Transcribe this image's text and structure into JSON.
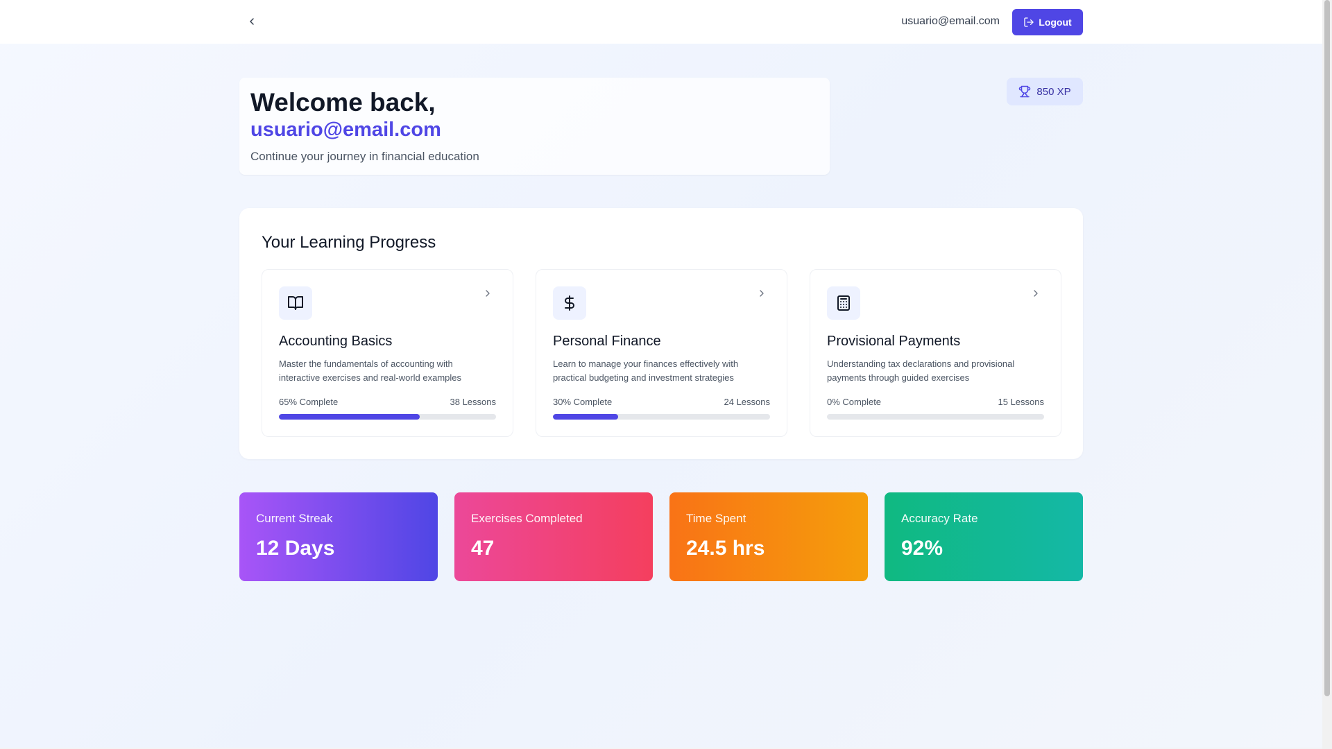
{
  "header": {
    "user_email": "usuario@email.com",
    "logout_label": "Logout"
  },
  "welcome": {
    "heading": "Welcome back,",
    "email": "usuario@email.com",
    "subtitle": "Continue your journey in financial education"
  },
  "xp": {
    "label": "850 XP"
  },
  "progress": {
    "title": "Your Learning Progress",
    "courses": [
      {
        "icon": "book-open-icon",
        "title": "Accounting Basics",
        "description": "Master the fundamentals of accounting with interactive exercises and real-world examples",
        "complete_label": "65% Complete",
        "lessons_label": "38 Lessons",
        "progress": 0.65
      },
      {
        "icon": "dollar-sign-icon",
        "title": "Personal Finance",
        "description": "Learn to manage your finances effectively with practical budgeting and investment strategies",
        "complete_label": "30% Complete",
        "lessons_label": "24 Lessons",
        "progress": 0.3
      },
      {
        "icon": "calculator-icon",
        "title": "Provisional Payments",
        "description": "Understanding tax declarations and provisional payments through guided exercises",
        "complete_label": "0% Complete",
        "lessons_label": "15 Lessons",
        "progress": 0.0
      }
    ]
  },
  "stats": [
    {
      "label": "Current Streak",
      "value": "12 Days"
    },
    {
      "label": "Exercises Completed",
      "value": "47"
    },
    {
      "label": "Time Spent",
      "value": "24.5 hrs"
    },
    {
      "label": "Accuracy Rate",
      "value": "92%"
    }
  ],
  "colors": {
    "accent": "#4f46e5",
    "streak_gradient": [
      "#a855f7",
      "#4f46e5"
    ],
    "exercises_gradient": [
      "#ec4899",
      "#f43f5e"
    ],
    "time_gradient": [
      "#f97316",
      "#f59e0b"
    ],
    "accuracy_gradient": [
      "#10b981",
      "#14b8a6"
    ]
  }
}
